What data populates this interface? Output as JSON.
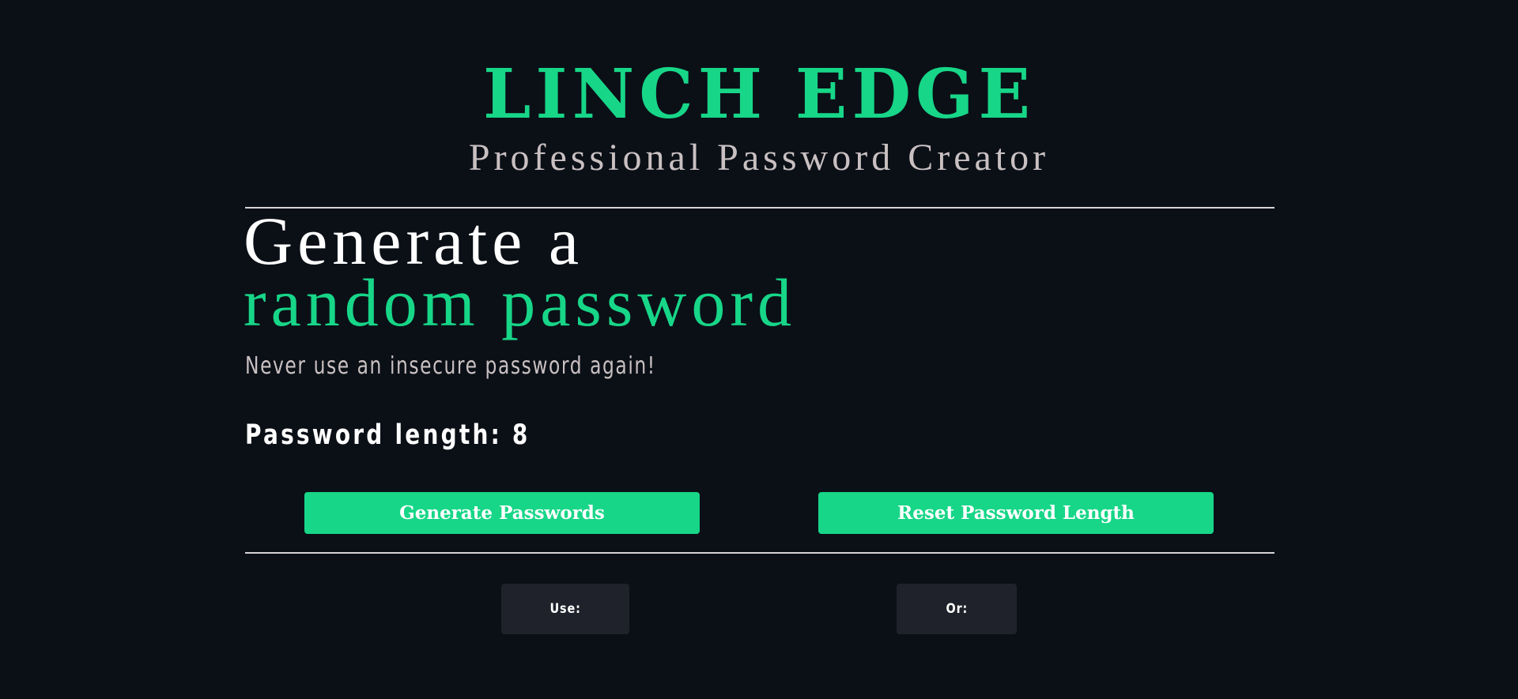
{
  "header": {
    "brand": "LINCH EDGE",
    "tagline": "Professional Password Creator"
  },
  "hero": {
    "headline_line1": "Generate a",
    "headline_line2": "random password",
    "subtext": "Never use an insecure password again!"
  },
  "settings": {
    "length_label": "Password length: 8",
    "length_value": 8
  },
  "actions": {
    "generate_label": "Generate Passwords",
    "reset_label": "Reset Password Length"
  },
  "results": {
    "use_label": "Use:",
    "or_label": "Or:"
  },
  "colors": {
    "background": "#0b1017",
    "accent": "#17d688",
    "muted_text": "#c9c0c1",
    "result_box": "#1f222a"
  }
}
